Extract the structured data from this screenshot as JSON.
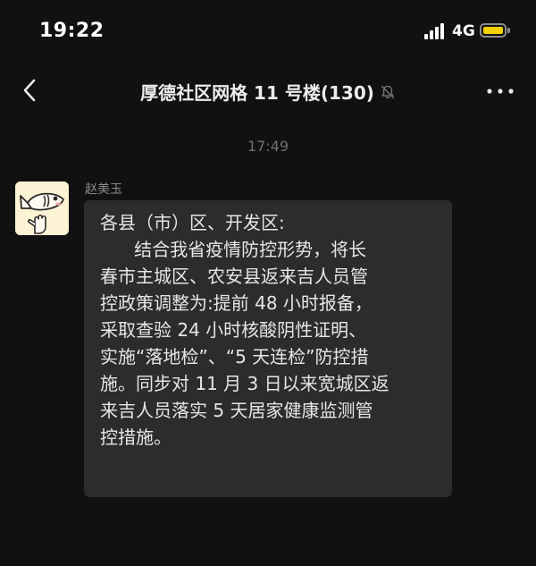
{
  "status_bar": {
    "time": "19:22",
    "network": "4G",
    "battery_color": "#f5d000"
  },
  "nav": {
    "back_icon": "chevron-left-icon",
    "title": "厚德社区网格 11 号楼(130)",
    "mute_icon": "bell-muted-icon",
    "more_icon": "more-dots-icon"
  },
  "chat": {
    "timestamp": "17:49",
    "message": {
      "sender": "赵美玉",
      "avatar_icon": "fish-cartoon-avatar",
      "lines": [
        "各县（市）区、开发区:",
        "      结合我省疫情防控形势，将长",
        "春市主城区、农安县返来吉人员管",
        "控政策调整为:提前 48 小时报备，",
        "采取查验 24 小时核酸阴性证明、",
        "实施“落地检”、“5 天连检”防控措",
        "施。同步对 11 月 3 日以来宽城区返",
        "来吉人员落实 5 天居家健康监测管",
        "控措施。"
      ]
    }
  },
  "colors": {
    "background": "#111111",
    "bubble": "#2c2c2c",
    "text": "#e6e6e6",
    "muted_text": "#6f6f6f"
  }
}
